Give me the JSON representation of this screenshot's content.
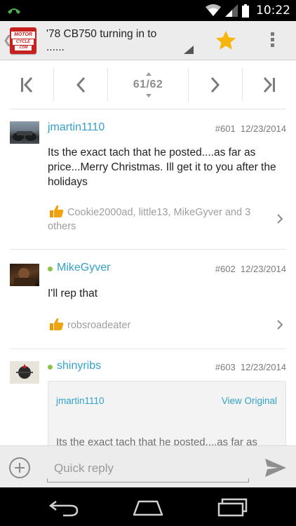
{
  "status_bar": {
    "time": "10:22"
  },
  "action_bar": {
    "logo_line1": "MOTOR",
    "logo_line2": "CYCLE",
    "logo_line3": ".COM",
    "title_line1": "'78 CB750 turning in to",
    "title_line2": "......",
    "accent_star_color": "#f5b50a"
  },
  "pager": {
    "current": "61",
    "total": "62",
    "label": "61/62"
  },
  "posts": [
    {
      "username": "jmartin1110",
      "number": "#601",
      "date": "12/23/2014",
      "online": false,
      "text": "Its the exact tach that he posted....as far as price...Merry Christmas. Ill get it to you after the holidays",
      "likes": "Cookie2000ad, little13, MikeGyver and 3 others"
    },
    {
      "username": "MikeGyver",
      "number": "#602",
      "date": "12/23/2014",
      "online": true,
      "text": "I'll rep that",
      "likes": "robsroadeater"
    },
    {
      "username": "shinyribs",
      "number": "#603",
      "date": "12/23/2014",
      "online": true,
      "quote_user": "jmartin1110",
      "quote_link": "View Original",
      "quote_text": "Its the exact tach that he posted....as far as"
    }
  ],
  "quick_reply": {
    "placeholder": "Quick reply"
  },
  "colors": {
    "link": "#33a1c9",
    "online": "#8bc34a",
    "like_thumb": "#f0a30a"
  }
}
